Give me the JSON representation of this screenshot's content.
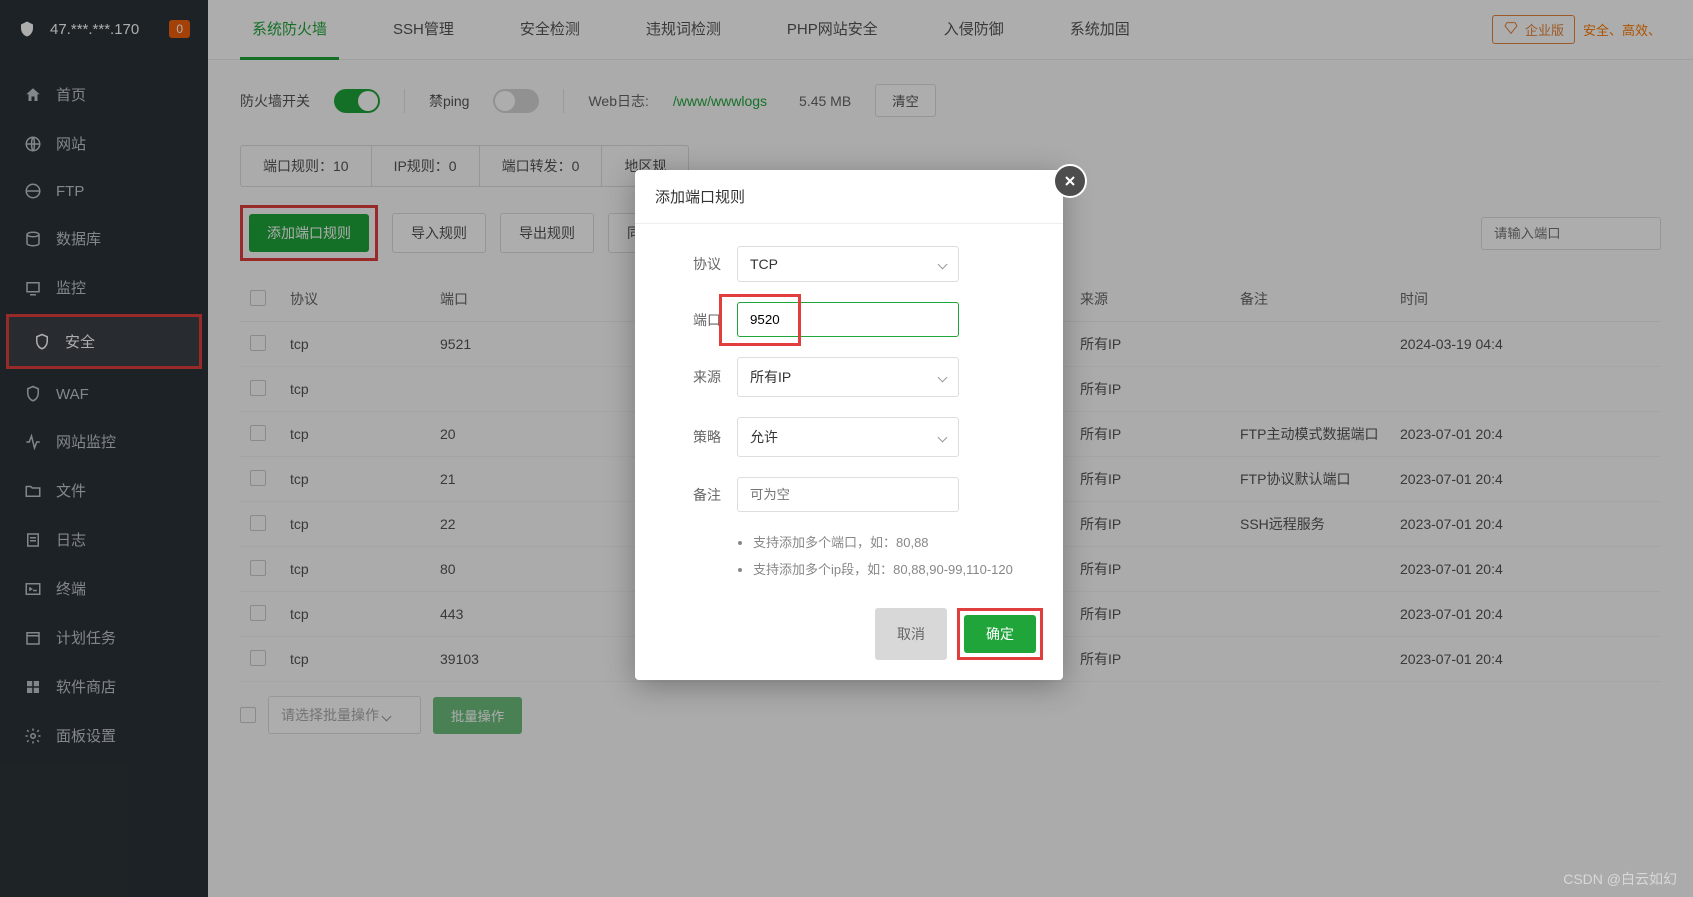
{
  "header": {
    "ip": "47.***.***.170",
    "notif_count": "0"
  },
  "sidebar": {
    "items": [
      {
        "label": "首页",
        "icon": "home-icon"
      },
      {
        "label": "网站",
        "icon": "globe-icon"
      },
      {
        "label": "FTP",
        "icon": "ftp-icon"
      },
      {
        "label": "数据库",
        "icon": "database-icon"
      },
      {
        "label": "监控",
        "icon": "monitor-icon"
      },
      {
        "label": "安全",
        "icon": "shield-icon"
      },
      {
        "label": "WAF",
        "icon": "waf-icon"
      },
      {
        "label": "网站监控",
        "icon": "pulse-icon"
      },
      {
        "label": "文件",
        "icon": "folder-icon"
      },
      {
        "label": "日志",
        "icon": "log-icon"
      },
      {
        "label": "终端",
        "icon": "terminal-icon"
      },
      {
        "label": "计划任务",
        "icon": "calendar-icon"
      },
      {
        "label": "软件商店",
        "icon": "app-icon"
      },
      {
        "label": "面板设置",
        "icon": "settings-icon"
      }
    ]
  },
  "tabs": {
    "items": [
      "系统防火墙",
      "SSH管理",
      "安全检测",
      "违规词检测",
      "PHP网站安全",
      "入侵防御",
      "系统加固"
    ],
    "enterprise": "企业版",
    "promo": "安全、高效、"
  },
  "toolbar": {
    "firewall_label": "防火墙开关",
    "ping_label": "禁ping",
    "log_label": "Web日志:",
    "log_path": "/www/wwwlogs",
    "log_size": "5.45 MB",
    "clear_btn": "清空"
  },
  "subtabs": {
    "items": [
      "端口规则：10",
      "IP规则：0",
      "端口转发：0",
      "地区规"
    ]
  },
  "actions": {
    "add_rule": "添加端口规则",
    "import_rule": "导入规则",
    "export_rule": "导出规则",
    "sync_port": "同步端口配置",
    "search_placeholder": "请输入端口"
  },
  "table": {
    "headers": {
      "protocol": "协议",
      "port": "端口",
      "source": "来源",
      "remark": "备注",
      "time": "时间"
    },
    "rows": [
      {
        "protocol": "tcp",
        "port": "9521",
        "source": "所有IP",
        "remark": "",
        "time": "2024-03-19 04:4"
      },
      {
        "protocol": "tcp",
        "port": "",
        "source": "所有IP",
        "remark": "",
        "time": ""
      },
      {
        "protocol": "tcp",
        "port": "20",
        "source": "所有IP",
        "remark": "FTP主动模式数据端口",
        "time": "2023-07-01 20:4"
      },
      {
        "protocol": "tcp",
        "port": "21",
        "source": "所有IP",
        "remark": "FTP协议默认端口",
        "time": "2023-07-01 20:4"
      },
      {
        "protocol": "tcp",
        "port": "22",
        "source": "所有IP",
        "remark": "SSH远程服务",
        "time": "2023-07-01 20:4"
      },
      {
        "protocol": "tcp",
        "port": "80",
        "source": "所有IP",
        "remark": "",
        "time": "2023-07-01 20:4"
      },
      {
        "protocol": "tcp",
        "port": "443",
        "source": "所有IP",
        "remark": "",
        "time": "2023-07-01 20:4"
      },
      {
        "protocol": "tcp",
        "port": "39103",
        "source": "所有IP",
        "remark": "",
        "time": "2023-07-01 20:4"
      }
    ]
  },
  "batch": {
    "placeholder": "请选择批量操作",
    "btn": "批量操作"
  },
  "modal": {
    "title": "添加端口规则",
    "labels": {
      "protocol": "协议",
      "port": "端口",
      "source": "来源",
      "strategy": "策略",
      "remark": "备注"
    },
    "values": {
      "protocol": "TCP",
      "port": "9520",
      "source": "所有IP",
      "strategy": "允许"
    },
    "remark_placeholder": "可为空",
    "hints": [
      "支持添加多个端口，如：80,88",
      "支持添加多个ip段，如：80,88,90-99,110-120"
    ],
    "cancel": "取消",
    "confirm": "确定"
  },
  "watermark": "CSDN @白云如幻"
}
